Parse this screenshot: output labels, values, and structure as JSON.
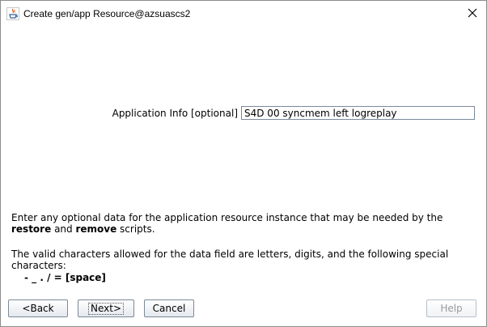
{
  "window": {
    "title": "Create gen/app Resource@azsuascs2",
    "close_glyph": "✕",
    "app_icon": "java-icon"
  },
  "form": {
    "label": "Application Info [optional]",
    "value": "S4D 00 syncmem left logreplay"
  },
  "description": {
    "line1_pre": "Enter any optional data for the application resource instance that may be needed by the ",
    "line1_bold1": "restore",
    "line1_mid": " and ",
    "line1_bold2": "remove",
    "line1_post": " scripts.",
    "line2": "The valid characters allowed for the data field are letters, digits, and the following special characters:",
    "special_chars": "- _ . / = [space]"
  },
  "buttons": {
    "back": "<Back",
    "next": "Next>",
    "cancel": "Cancel",
    "help": "Help"
  },
  "colors": {
    "border": "#7a8a99",
    "disabled_text": "#9a9a9a"
  }
}
